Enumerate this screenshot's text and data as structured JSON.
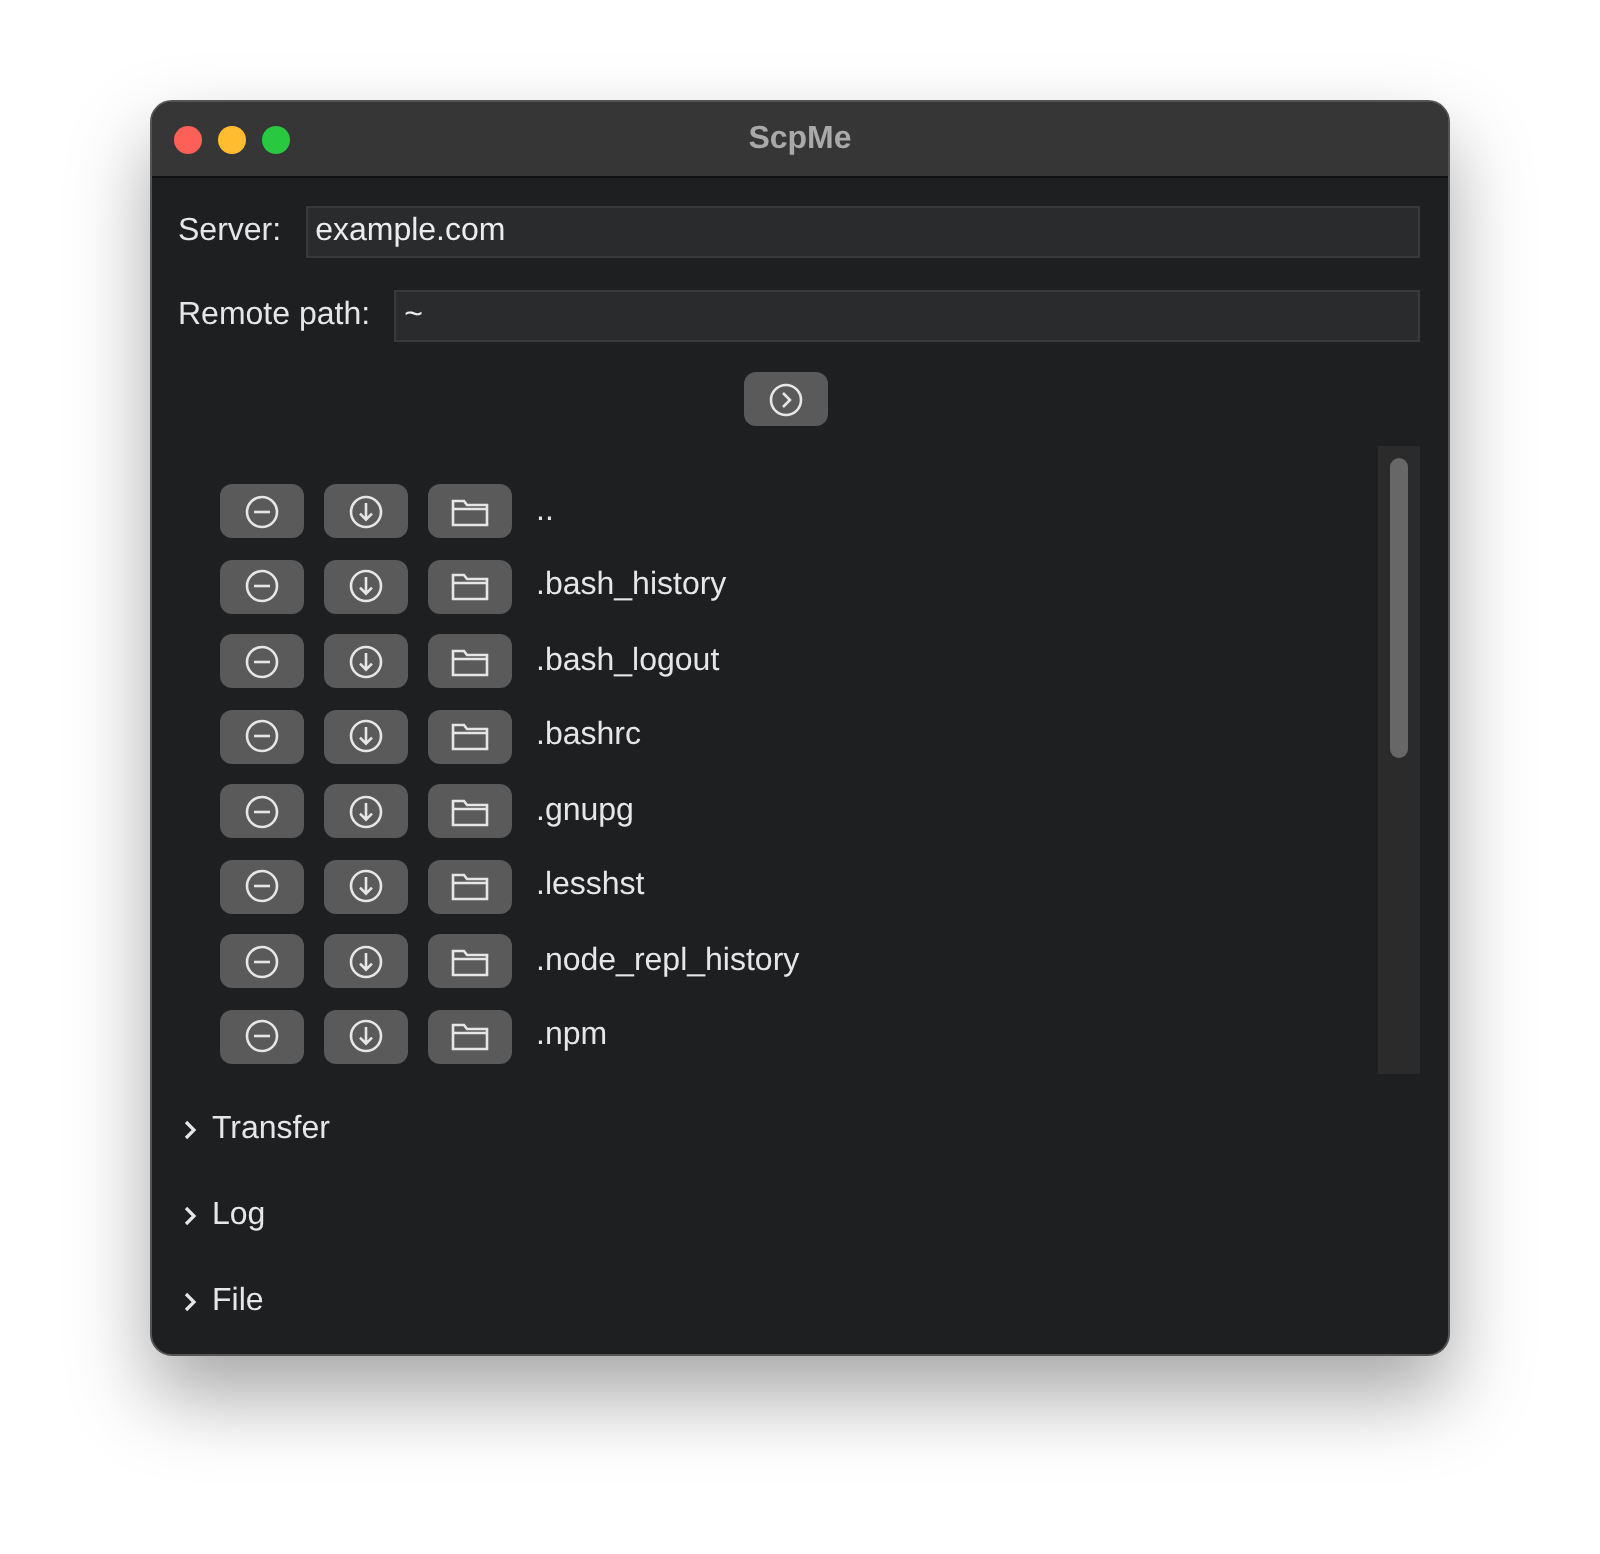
{
  "window": {
    "title": "ScpMe"
  },
  "server": {
    "label": "Server:",
    "value": "example.com"
  },
  "remote_path": {
    "label": "Remote path:",
    "value": "~"
  },
  "files": [
    {
      "name": ".."
    },
    {
      "name": ".bash_history"
    },
    {
      "name": ".bash_logout"
    },
    {
      "name": ".bashrc"
    },
    {
      "name": ".gnupg"
    },
    {
      "name": ".lesshst"
    },
    {
      "name": ".node_repl_history"
    },
    {
      "name": ".npm"
    }
  ],
  "sections": [
    {
      "label": "Transfer",
      "expanded": false
    },
    {
      "label": "Log",
      "expanded": false
    },
    {
      "label": "File",
      "expanded": false
    }
  ]
}
